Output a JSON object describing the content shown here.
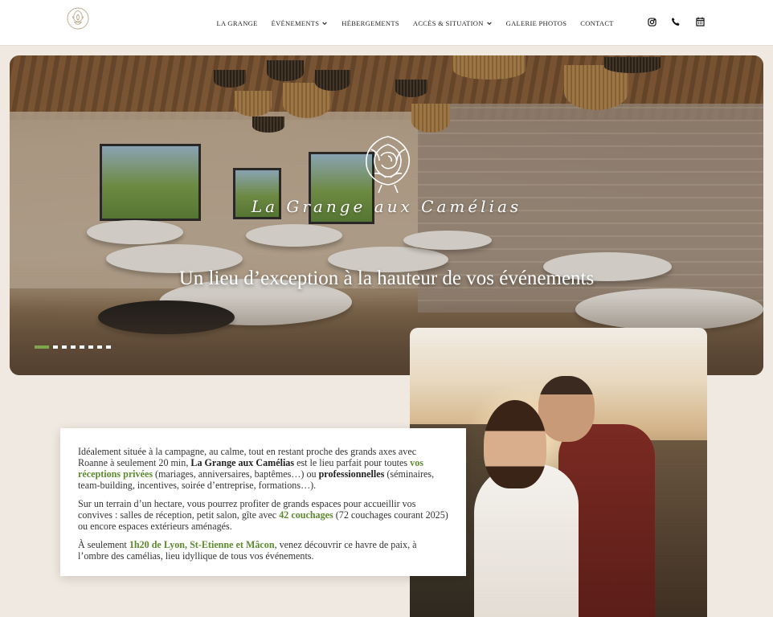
{
  "header": {
    "logo_icon": "camellia-flower-logo-icon",
    "nav": [
      {
        "label": "LA GRANGE",
        "dropdown": false
      },
      {
        "label": "ÉVÉNEMENTS",
        "dropdown": true
      },
      {
        "label": "HÉBERGEMENTS",
        "dropdown": false
      },
      {
        "label": "ACCÈS & SITUATION",
        "dropdown": true
      },
      {
        "label": "GALERIE PHOTOS",
        "dropdown": false
      },
      {
        "label": "CONTACT",
        "dropdown": false
      }
    ],
    "icons": [
      "instagram-icon",
      "phone-icon",
      "calendar-icon"
    ]
  },
  "hero": {
    "brand": "La Grange aux Camélias",
    "title": "Un lieu d’exception à la hauteur de vos événements",
    "slides_count": 8,
    "active_slide": 0
  },
  "intro": {
    "p1": {
      "a": "Idéalement située à la campagne, au calme, tout en restant proche des grands axes avec Roanne à seulement 20 min, ",
      "b": "La Grange aux Camélias",
      "c": " est le lieu parfait pour toutes ",
      "d": "vos réceptions privées",
      "e": " (mariages, anniversaires, baptêmes…) ou ",
      "f": "professionnelles",
      "g": " (séminaires, team-building, incentives, soirée d’entreprise, formations…)."
    },
    "p2": {
      "a": "Sur un terrain d’un hectare, vous pourrez profiter de grands espaces pour accueillir vos convives : salles de réception, petit salon, gîte avec ",
      "b": "42 couchages",
      "c": " (72 couchages courant 2025) ou encore espaces extérieurs aménagés."
    },
    "p3": {
      "a": "À seulement ",
      "b": "1h20 de Lyon, St-Etienne et Mâcon",
      "c": ", venez découvrir ce havre de paix, à l’ombre des camélias, lieu idyllique de tous vos événements."
    }
  },
  "colors": {
    "accent": "#5c8a2e",
    "background": "#efe9e1",
    "slider_active": "#7fa64a"
  }
}
